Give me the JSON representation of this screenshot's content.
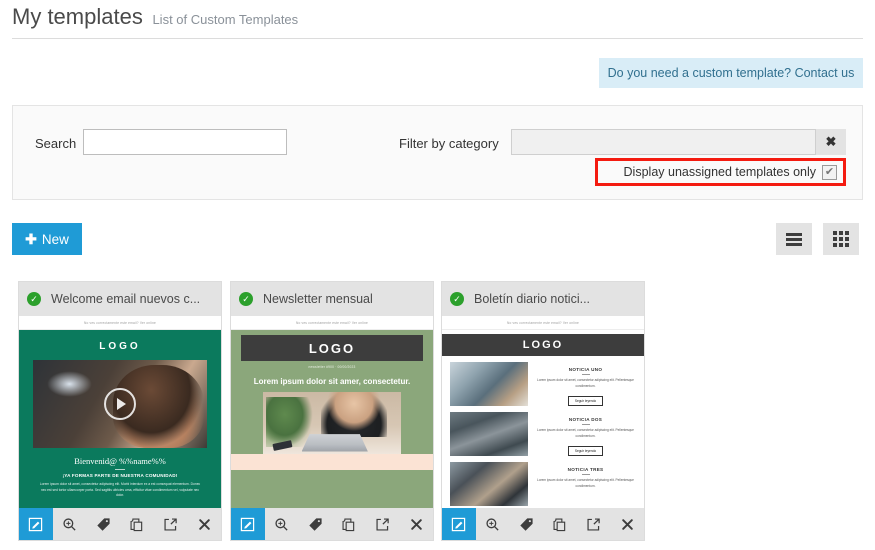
{
  "header": {
    "title": "My templates",
    "subtitle": "List of Custom Templates"
  },
  "contact_banner": {
    "text": "Do you need a custom template? Contact us",
    "background": "#d9edf7",
    "color": "#31708f"
  },
  "filters": {
    "search_label": "Search",
    "search_value": "",
    "search_placeholder": "",
    "category_label": "Filter by category",
    "category_value": "",
    "category_placeholder": "",
    "clear_icon": "✖",
    "unassigned_label": "Display unassigned templates only",
    "unassigned_checked": true,
    "unassigned_check_glyph": "✔",
    "highlight_color": "#f41b10"
  },
  "toolbar": {
    "new_label": "New",
    "new_icon": "✚",
    "new_color": "#1f9bd6",
    "view_list_name": "list-view",
    "view_grid_name": "grid-view"
  },
  "card_actions": [
    {
      "name": "edit-action",
      "icon": "pencil-square-icon"
    },
    {
      "name": "preview-action",
      "icon": "magnifier-icon"
    },
    {
      "name": "tag-action",
      "icon": "tag-icon"
    },
    {
      "name": "duplicate-action",
      "icon": "copy-icon"
    },
    {
      "name": "export-action",
      "icon": "share-icon"
    },
    {
      "name": "delete-action",
      "icon": "close-icon"
    }
  ],
  "templates": [
    {
      "title": "Welcome email nuevos c...",
      "status_icon": "check-circle-icon",
      "status_color": "#2ca02c",
      "preview": {
        "pretext": "No ves correctamente este email? Ver online",
        "logo": "LOGO",
        "heading": "Bienvenid@ %%name%%",
        "subheading": "¡YA FORMAS PARTE DE NUESTRA COMUNIDAD!",
        "body": "Lorem ipsum dolor sit amet, consectetur adipiscing elit. Morbi interdum ex a est consequat elementum. Donec nec est sed tortor ullamcorper porta. Sed sagittis ultricies urna, efficitur vitae condimentum vel, vulputate nec dolor.",
        "accent": "#0b7a5d"
      }
    },
    {
      "title": "Newsletter mensual",
      "status_icon": "check-circle-icon",
      "status_color": "#2ca02c",
      "preview": {
        "pretext": "No ves correctamente este email? Ver online",
        "logo": "LOGO",
        "meta": "newsletter #900 · 00/00/2023",
        "headline": "Lorem ipsum dolor sit amer, consectetur.",
        "accent": "#8ba77b"
      }
    },
    {
      "title": "Boletín diario notici...",
      "status_icon": "check-circle-icon",
      "status_color": "#2ca02c",
      "preview": {
        "pretext": "No ves correctamente este email? Ver online",
        "logo": "LOGO",
        "accent": "#3d3d3d",
        "news": [
          {
            "title": "NOTICIA UNO",
            "body": "Lorem ipsum dolor sit amet, consectetur adipiscing elit. Pellentesque condimentum.",
            "cta": "Seguir leyendo"
          },
          {
            "title": "NOTICIA DOS",
            "body": "Lorem ipsum dolor sit amet, consectetur adipiscing elit. Pellentesque condimentum.",
            "cta": "Seguir leyendo"
          },
          {
            "title": "NOTICIA TRES",
            "body": "Lorem ipsum dolor sit amet, consectetur adipiscing elit. Pellentesque condimentum.",
            "cta": "Seguir leyendo"
          }
        ]
      }
    }
  ]
}
